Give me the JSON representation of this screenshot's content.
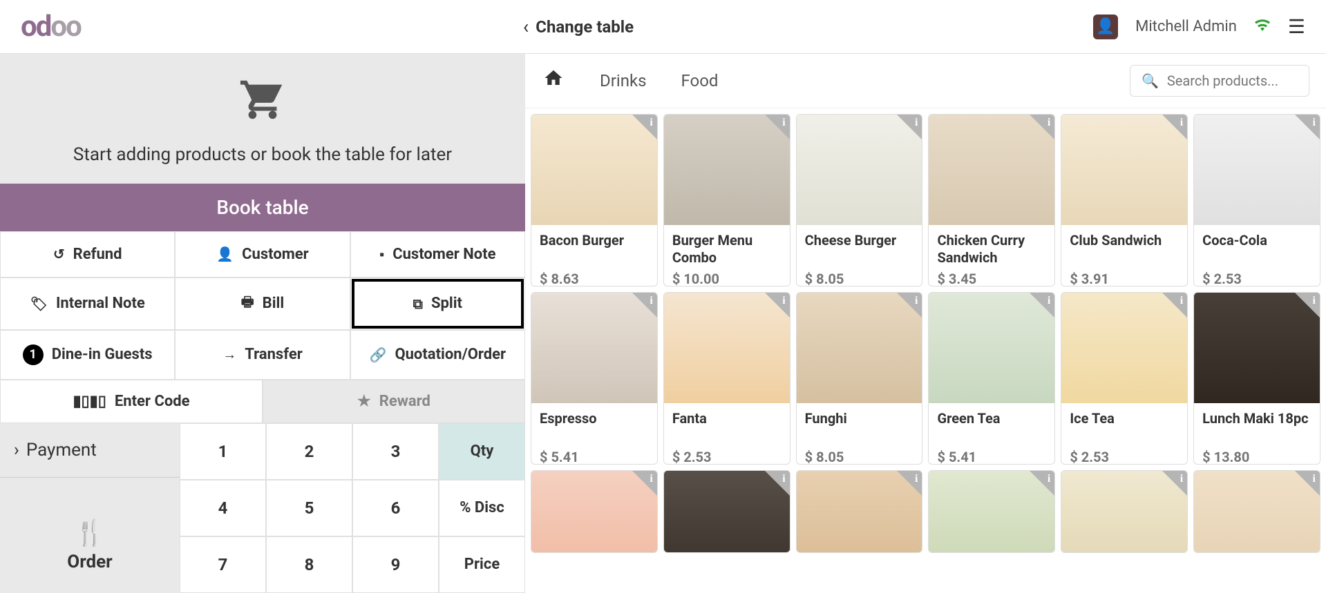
{
  "header": {
    "logo": "odoo",
    "change_table": "Change table",
    "username": "Mitchell Admin"
  },
  "left": {
    "empty_text": "Start adding products or book the table for later",
    "book_table": "Book table",
    "actions": {
      "refund": "Refund",
      "customer": "Customer",
      "customer_note": "Customer Note",
      "internal_note": "Internal Note",
      "bill": "Bill",
      "split": "Split",
      "guests_count": "1",
      "guests": "Dine-in Guests",
      "transfer": "Transfer",
      "quotation": "Quotation/Order",
      "enter_code": "Enter Code",
      "reward": "Reward"
    },
    "payment": "Payment",
    "order_label": "Order",
    "numpad": {
      "n1": "1",
      "n2": "2",
      "n3": "3",
      "qty": "Qty",
      "n4": "4",
      "n5": "5",
      "n6": "6",
      "disc": "% Disc",
      "n7": "7",
      "n8": "8",
      "n9": "9",
      "price": "Price"
    }
  },
  "right": {
    "categories": [
      "Drinks",
      "Food"
    ],
    "search_placeholder": "Search products...",
    "products": [
      {
        "name": "Bacon Burger",
        "price": "$ 8.63",
        "cls": "burger"
      },
      {
        "name": "Burger Menu Combo",
        "price": "$ 10.00",
        "cls": "combo"
      },
      {
        "name": "Cheese Burger",
        "price": "$ 8.05",
        "cls": "cheese"
      },
      {
        "name": "Chicken Curry Sandwich",
        "price": "$ 3.45",
        "cls": "chicken"
      },
      {
        "name": "Club Sandwich",
        "price": "$ 3.91",
        "cls": "club"
      },
      {
        "name": "Coca-Cola",
        "price": "$ 2.53",
        "cls": "coke"
      },
      {
        "name": "Espresso",
        "price": "$ 5.41",
        "cls": "espresso"
      },
      {
        "name": "Fanta",
        "price": "$ 2.53",
        "cls": "fanta"
      },
      {
        "name": "Funghi",
        "price": "$ 8.05",
        "cls": "funghi"
      },
      {
        "name": "Green Tea",
        "price": "$ 5.41",
        "cls": "greentea"
      },
      {
        "name": "Ice Tea",
        "price": "$ 2.53",
        "cls": "icetea"
      },
      {
        "name": "Lunch Maki 18pc",
        "price": "$ 13.80",
        "cls": "maki"
      },
      {
        "name": "",
        "price": "",
        "cls": "salmon",
        "partial": true
      },
      {
        "name": "",
        "price": "",
        "cls": "temaki",
        "partial": true
      },
      {
        "name": "",
        "price": "",
        "cls": "pizza",
        "partial": true
      },
      {
        "name": "",
        "price": "",
        "cls": "drink1",
        "partial": true
      },
      {
        "name": "",
        "price": "",
        "cls": "drink2",
        "partial": true
      },
      {
        "name": "",
        "price": "",
        "cls": "sandwich2",
        "partial": true
      }
    ]
  }
}
